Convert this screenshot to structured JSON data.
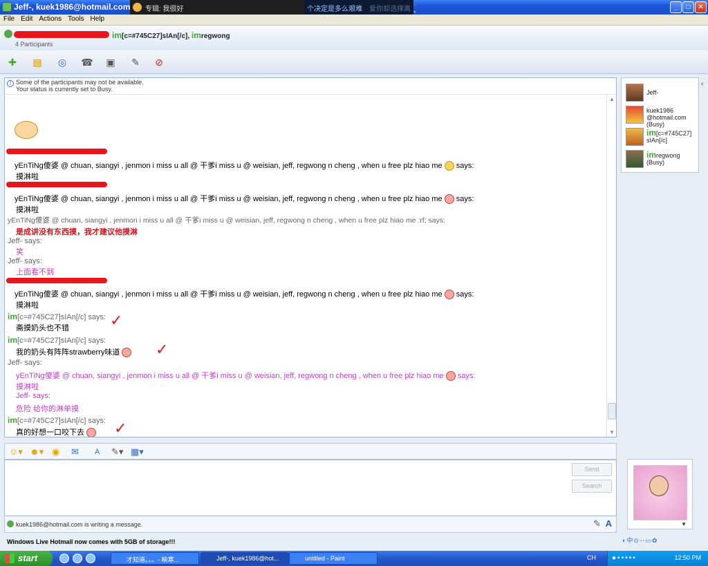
{
  "window": {
    "title": "Jeff-, kuek1986@hotmail.com, ...",
    "media_player": {
      "title": "专辑: 我很好",
      "ticker": "个决定是多么艰难",
      "ticker_dim": "爱你却选择离"
    },
    "controls": {
      "minimize": "_",
      "maximize": "□",
      "close": "✕"
    }
  },
  "menu": [
    "File",
    "Edit",
    "Actions",
    "Tools",
    "Help"
  ],
  "header": {
    "names": "[c=#745C27]sIAn[/c],",
    "names2": "regwong",
    "participants": "4 Participants"
  },
  "notice": {
    "line1": "Some of the participants may not be available.",
    "line2": "Your status is currently set to Busy."
  },
  "messages": [
    {
      "text": "yEnTiNg傻婆 @ chuan, siangyi , jenmon i miss u all @ 干爹i miss u @ weisian, jeff, regwong n cheng , when u free plz hiao me",
      "says": "says:",
      "body": "摸淋啦"
    },
    {
      "text": "yEnTiNg傻婆 @ chuan, siangyi , jenmon i miss u all @ 干爹i miss u @ weisian, jeff, regwong n cheng , when u free plz hiao me",
      "says": "says:",
      "body": "摸淋啦"
    },
    {
      "text": "yEnTiNg傻婆 @ chuan, siangyi , jenmon i miss u all @ 干爹i miss u @ weisian, jeff, regwong n cheng , when u free plz hiao me :rf; says:",
      "body": "是成讲没有东西摸，我才建议他摸淋"
    },
    {
      "says": "Jeff- says:",
      "body": "笑"
    },
    {
      "says": "Jeff- says:",
      "body": "上面看不到"
    },
    {
      "text": "yEnTiNg傻婆 @ chuan, siangyi , jenmon i miss u all @ 干爹i miss u @ weisian, jeff, regwong n cheng , when u free plz hiao me",
      "says": "says:",
      "body": "摸淋啦"
    },
    {
      "says": "[c=#745C27]sIAn[/c] says:",
      "body": "斋摸奶头也不错"
    },
    {
      "says": "[c=#745C27]sIAn[/c] says:",
      "body": "我的奶头有阵阵strawberry味道"
    },
    {
      "says": "Jeff- says:",
      "text": "yEnTiNg傻婆 @ chuan, siangyi , jenmon i miss u all @ 干爹i miss u @ weisian, jeff, regwong n cheng , when u free plz hiao me",
      "says2": "says:",
      "body": "摸淋啦",
      "inner_says": "Jeff- says:",
      "inner_body": "危险 给你的淋单摸"
    },
    {
      "says": "[c=#745C27]sIAn[/c] says:",
      "body": "真的好想一口咬下去"
    }
  ],
  "im_tag": "im",
  "compose": {
    "send": "Send",
    "search": "Search",
    "typing": "kuek1986@hotmail.com is writing a message.",
    "ad": "Windows Live Hotmail now comes with 5GB of storage!!!"
  },
  "participants": [
    {
      "name": "Jeff-"
    },
    {
      "name": "kuek1986\n@hotmail.com\n(Busy)"
    },
    {
      "name": "[c=#745C27]\nsIAn[/c]"
    },
    {
      "name": "regwong\n(Busy)"
    }
  ],
  "taskbar": {
    "start": "start",
    "tasks": [
      "才知道。。。- 映寒...",
      "Jeff-, kuek1986@hot...",
      "untitled - Paint"
    ],
    "lang": "CH",
    "clock": "12:50 PM"
  },
  "colors": {
    "accent": "#1d4fc9",
    "redaction": "#e8151b",
    "pink": "#c43ec8",
    "strong": "#d4141b"
  }
}
